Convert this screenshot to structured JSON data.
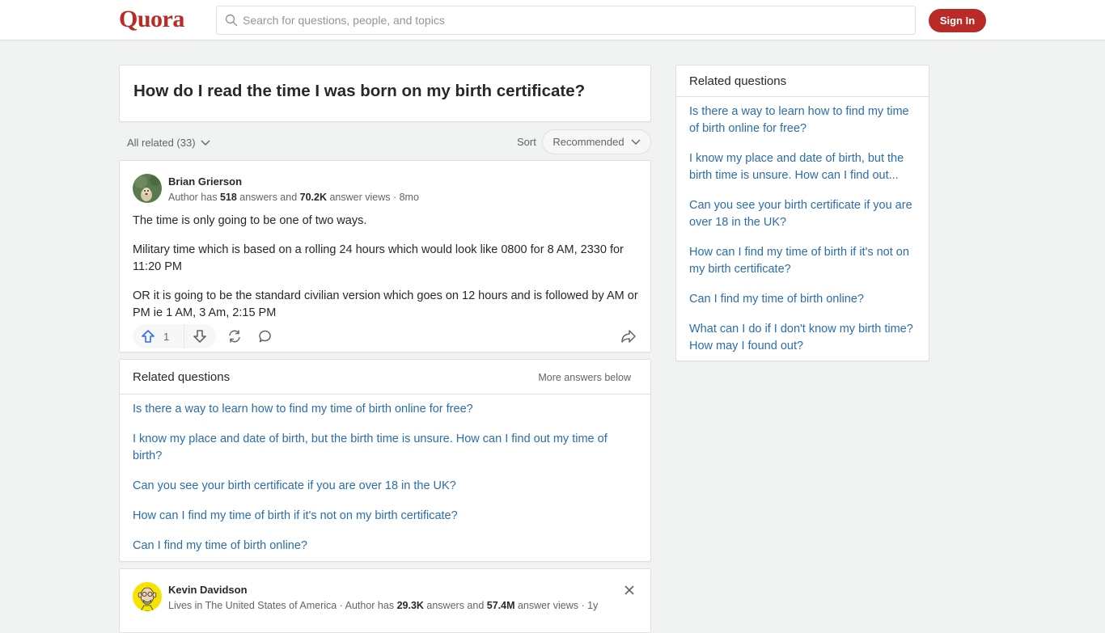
{
  "header": {
    "logo": "Quora",
    "search_placeholder": "Search for questions, people, and topics",
    "signin_label": "Sign In",
    "brand_color": "#b92b27"
  },
  "question": {
    "title": "How do I read the time I was born on my birth certificate?"
  },
  "filters": {
    "all_related": "All related (33)",
    "sort_label": "Sort",
    "sort_value": "Recommended"
  },
  "answer1": {
    "author": "Brian Grierson",
    "meta_prefix": "Author has ",
    "answers_count": "518",
    "meta_mid": " answers and ",
    "views_count": "70.2K",
    "meta_suffix": " answer views · 8mo",
    "paragraphs": [
      "The time is only going to be one of two ways.",
      "Military time which is based on a rolling 24 hours which would look like 0800 for 8 AM, 2330 for 11:20 PM",
      "OR it is going to be the standard civilian version which goes on 12 hours and is followed by AM or PM ie 1 AM, 3 Am, 2:15 PM"
    ],
    "upvotes": "1"
  },
  "related_inline": {
    "title": "Related questions",
    "more": "More answers below",
    "items": [
      "Is there a way to learn how to find my time of birth online for free?",
      "I know my place and date of birth, but the birth time is unsure. How can I find out my time of birth?",
      "Can you see your birth certificate if you are over 18 in the UK?",
      "How can I find my time of birth if it's not on my birth certificate?",
      "Can I find my time of birth online?"
    ]
  },
  "answer2": {
    "author": "Kevin Davidson",
    "meta_prefix": "Lives in The United States of America · Author has ",
    "answers_count": "29.3K",
    "meta_mid": " answers and ",
    "views_count": "57.4M",
    "meta_suffix": " answer views · 1y"
  },
  "sidebar": {
    "title": "Related questions",
    "items": [
      "Is there a way to learn how to find my time of birth online for free?",
      "I know my place and date of birth, but the birth time is unsure. How can I find out...",
      "Can you see your birth certificate if you are over 18 in the UK?",
      "How can I find my time of birth if it's not on my birth certificate?",
      "Can I find my time of birth online?",
      "What can I do if I don't know my birth time? How may I found out?"
    ]
  }
}
